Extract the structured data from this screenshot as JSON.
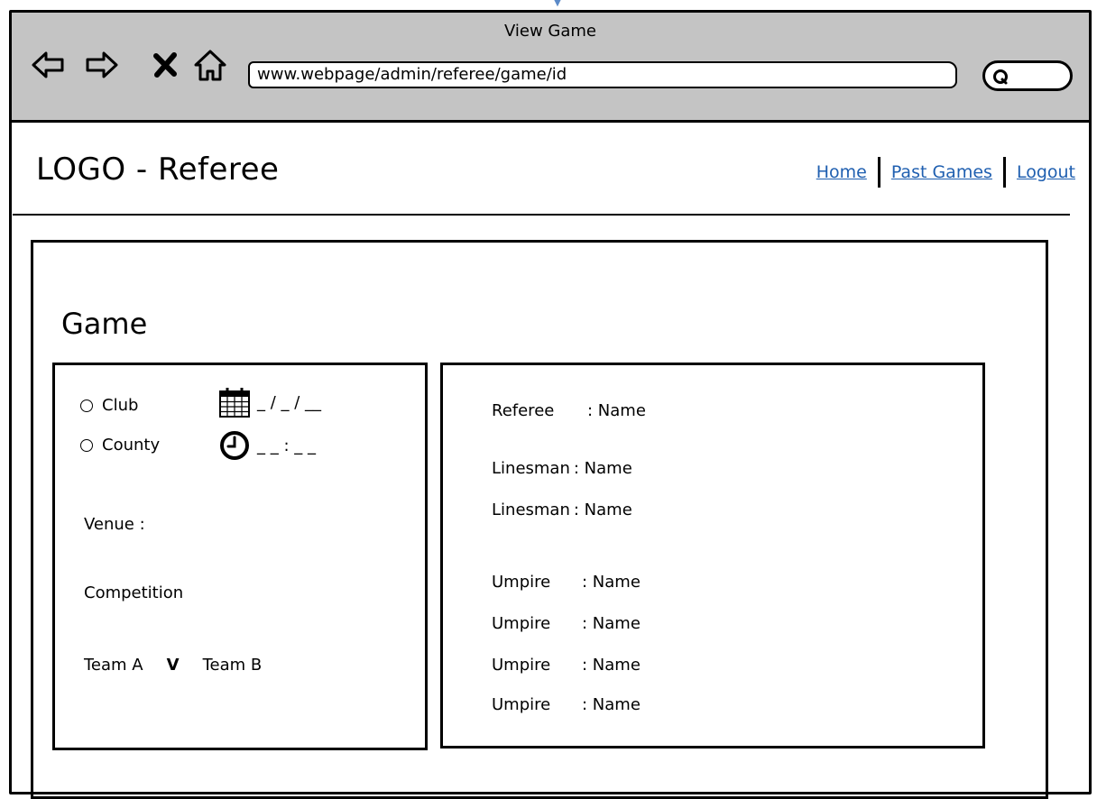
{
  "browser": {
    "window_title": "View Game",
    "url": "www.webpage/admin/referee/game/id",
    "icons": [
      "back-arrow-icon",
      "forward-arrow-icon",
      "close-x-icon",
      "home-icon",
      "search-icon"
    ]
  },
  "header": {
    "logo": "LOGO - Referee",
    "nav": {
      "home": "Home",
      "past_games": "Past Games",
      "logout": "Logout"
    }
  },
  "main": {
    "title": "Game",
    "game_type_options": [
      "Club",
      "County"
    ],
    "date_placeholder": "_ / _ / __",
    "time_placeholder": "_ _ : _ _",
    "venue_label": "Venue :",
    "competition_label": "Competition",
    "team_a": "Team A",
    "versus": "V",
    "team_b": "Team B"
  },
  "officials": [
    {
      "role": "Referee",
      "value": ": Name"
    },
    {
      "role": "Linesman",
      "value": ": Name"
    },
    {
      "role": "Linesman",
      "value": ": Name"
    },
    {
      "role": "Umpire",
      "value": ": Name"
    },
    {
      "role": "Umpire",
      "value": ": Name"
    },
    {
      "role": "Umpire",
      "value": ": Name"
    },
    {
      "role": "Umpire",
      "value": ": Name"
    }
  ]
}
